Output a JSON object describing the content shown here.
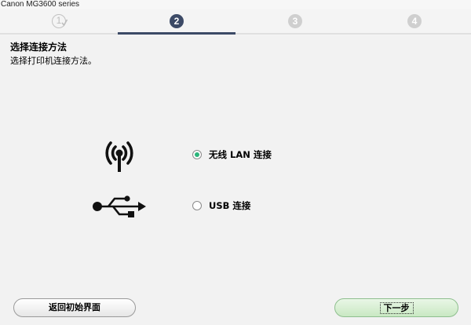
{
  "window": {
    "title": "Canon MG3600 series"
  },
  "steps": [
    {
      "label": "1",
      "state": "done"
    },
    {
      "label": "2",
      "state": "active"
    },
    {
      "label": "3",
      "state": "future"
    },
    {
      "label": "4",
      "state": "future"
    }
  ],
  "page": {
    "title": "选择连接方法",
    "subtitle": "选择打印机连接方法。"
  },
  "options": [
    {
      "label": "无线 LAN 连接",
      "icon": "wireless-icon",
      "selected": true
    },
    {
      "label": "USB 连接",
      "icon": "usb-icon",
      "selected": false
    }
  ],
  "buttons": {
    "back_label": "返回初始界面",
    "next_label": "下一步"
  },
  "colors": {
    "active_step": "#3c4a66",
    "radio_selected": "#2bb57b",
    "next_button": "#c9e8c3"
  }
}
